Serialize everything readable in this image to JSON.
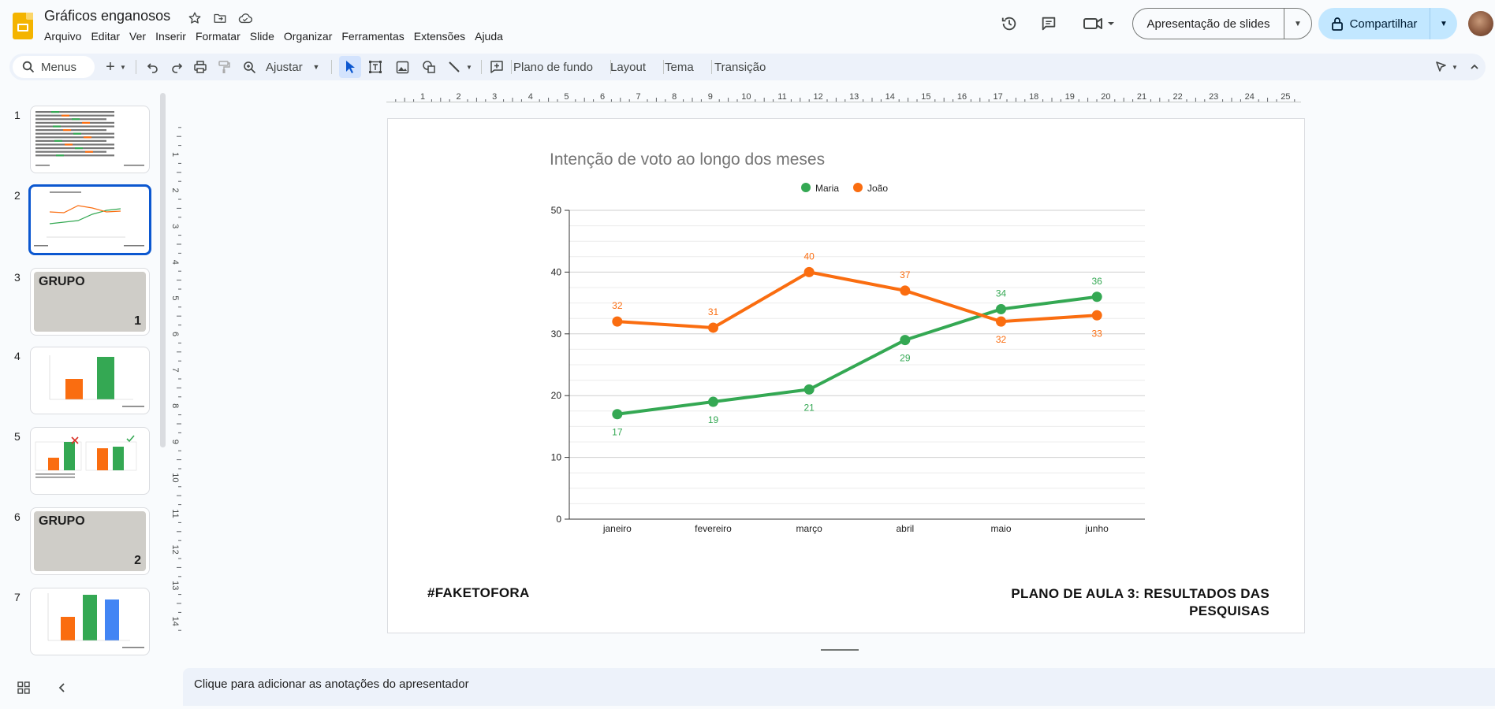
{
  "header": {
    "doc_title": "Gráficos enganosos",
    "menu": [
      "Arquivo",
      "Editar",
      "Ver",
      "Inserir",
      "Formatar",
      "Slide",
      "Organizar",
      "Ferramentas",
      "Extensões",
      "Ajuda"
    ],
    "slideshow_label": "Apresentação de slides",
    "share_label": "Compartilhar"
  },
  "toolbar": {
    "search_label": "Menus",
    "zoom_label": "Ajustar",
    "background_label": "Plano de fundo",
    "layout_label": "Layout",
    "theme_label": "Tema",
    "transition_label": "Transição"
  },
  "sidebar": {
    "slides": [
      {
        "number": "1",
        "kind": "text"
      },
      {
        "number": "2",
        "kind": "line-chart"
      },
      {
        "number": "3",
        "kind": "group",
        "title": "GRUPO",
        "num": "1"
      },
      {
        "number": "4",
        "kind": "bar-chart"
      },
      {
        "number": "5",
        "kind": "compare"
      },
      {
        "number": "6",
        "kind": "group",
        "title": "GRUPO",
        "num": "2"
      },
      {
        "number": "7",
        "kind": "bar-chart-3"
      }
    ]
  },
  "slide": {
    "footer_left": "#FAKETOFORA",
    "footer_right": "PLANO DE AULA  3: RESULTADOS DAS PESQUISAS"
  },
  "notes": {
    "placeholder": "Clique para adicionar as anotações do apresentador"
  },
  "colors": {
    "maria": "#34a853",
    "joao": "#fa6d10",
    "accent": "#0b57d0"
  },
  "chart_data": {
    "type": "line",
    "title": "Intenção de voto ao longo dos meses",
    "categories": [
      "janeiro",
      "fevereiro",
      "março",
      "abril",
      "maio",
      "junho"
    ],
    "series": [
      {
        "name": "Maria",
        "values": [
          17,
          19,
          21,
          29,
          34,
          36
        ]
      },
      {
        "name": "João",
        "values": [
          32,
          31,
          40,
          37,
          32,
          33
        ]
      }
    ],
    "ylim": [
      0,
      50
    ],
    "yticks": [
      0,
      10,
      20,
      30,
      40,
      50
    ],
    "legend": "top",
    "grid": true
  },
  "rulers": {
    "h_labels": [
      "1",
      "2",
      "3",
      "4",
      "5",
      "6",
      "7",
      "8",
      "9",
      "10",
      "11",
      "12",
      "13",
      "14",
      "15",
      "16",
      "17",
      "18",
      "19",
      "20",
      "21",
      "22",
      "23",
      "24",
      "25"
    ],
    "v_labels": [
      "1",
      "2",
      "3",
      "4",
      "5",
      "6",
      "7",
      "8",
      "9",
      "10",
      "11",
      "12",
      "13",
      "14"
    ]
  }
}
